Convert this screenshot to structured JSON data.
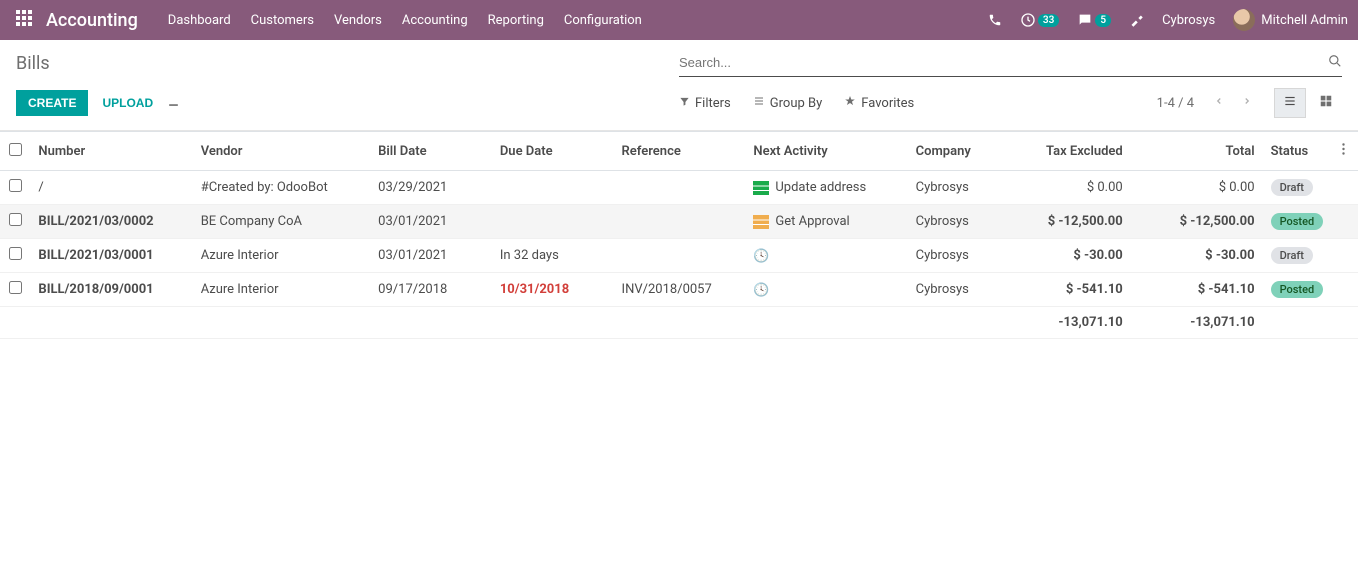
{
  "header": {
    "app_name": "Accounting",
    "menus": [
      "Dashboard",
      "Customers",
      "Vendors",
      "Accounting",
      "Reporting",
      "Configuration"
    ],
    "clock_badge": "33",
    "chat_badge": "5",
    "company": "Cybrosys",
    "user": "Mitchell Admin"
  },
  "cp": {
    "breadcrumb": "Bills",
    "search_placeholder": "Search...",
    "create": "CREATE",
    "upload": "UPLOAD",
    "filters": "Filters",
    "group_by": "Group By",
    "favorites": "Favorites",
    "pager": "1-4 / 4"
  },
  "columns": {
    "number": "Number",
    "vendor": "Vendor",
    "bill_date": "Bill Date",
    "due_date": "Due Date",
    "reference": "Reference",
    "next_activity": "Next Activity",
    "company": "Company",
    "tax_excluded": "Tax Excluded",
    "total": "Total",
    "status": "Status"
  },
  "rows": [
    {
      "number": "/",
      "vendor": "#Created by: OdooBot",
      "bill_date": "03/29/2021",
      "due_date": "",
      "reference": "",
      "activity_icon": "green",
      "activity": "Update address",
      "company": "Cybrosys",
      "tax_excluded": "$ 0.00",
      "total": "$ 0.00",
      "status": "Draft",
      "status_class": "badge-draft",
      "bold": false,
      "overdue": false,
      "highlight": false
    },
    {
      "number": "BILL/2021/03/0002",
      "vendor": "BE Company CoA",
      "bill_date": "03/01/2021",
      "due_date": "",
      "reference": "",
      "activity_icon": "orange",
      "activity": "Get Approval",
      "company": "Cybrosys",
      "tax_excluded": "$ -12,500.00",
      "total": "$ -12,500.00",
      "status": "Posted",
      "status_class": "badge-posted",
      "bold": true,
      "overdue": false,
      "highlight": true
    },
    {
      "number": "BILL/2021/03/0001",
      "vendor": "Azure Interior",
      "bill_date": "03/01/2021",
      "due_date": "In 32 days",
      "reference": "",
      "activity_icon": "clock",
      "activity": "",
      "company": "Cybrosys",
      "tax_excluded": "$ -30.00",
      "total": "$ -30.00",
      "status": "Draft",
      "status_class": "badge-draft",
      "bold": true,
      "overdue": false,
      "highlight": false
    },
    {
      "number": "BILL/2018/09/0001",
      "vendor": "Azure Interior",
      "bill_date": "09/17/2018",
      "due_date": "10/31/2018",
      "reference": "INV/2018/0057",
      "activity_icon": "clock",
      "activity": "",
      "company": "Cybrosys",
      "tax_excluded": "$ -541.10",
      "total": "$ -541.10",
      "status": "Posted",
      "status_class": "badge-posted",
      "bold": true,
      "overdue": true,
      "highlight": false
    }
  ],
  "footer": {
    "tax_excluded": "-13,071.10",
    "total": "-13,071.10"
  }
}
